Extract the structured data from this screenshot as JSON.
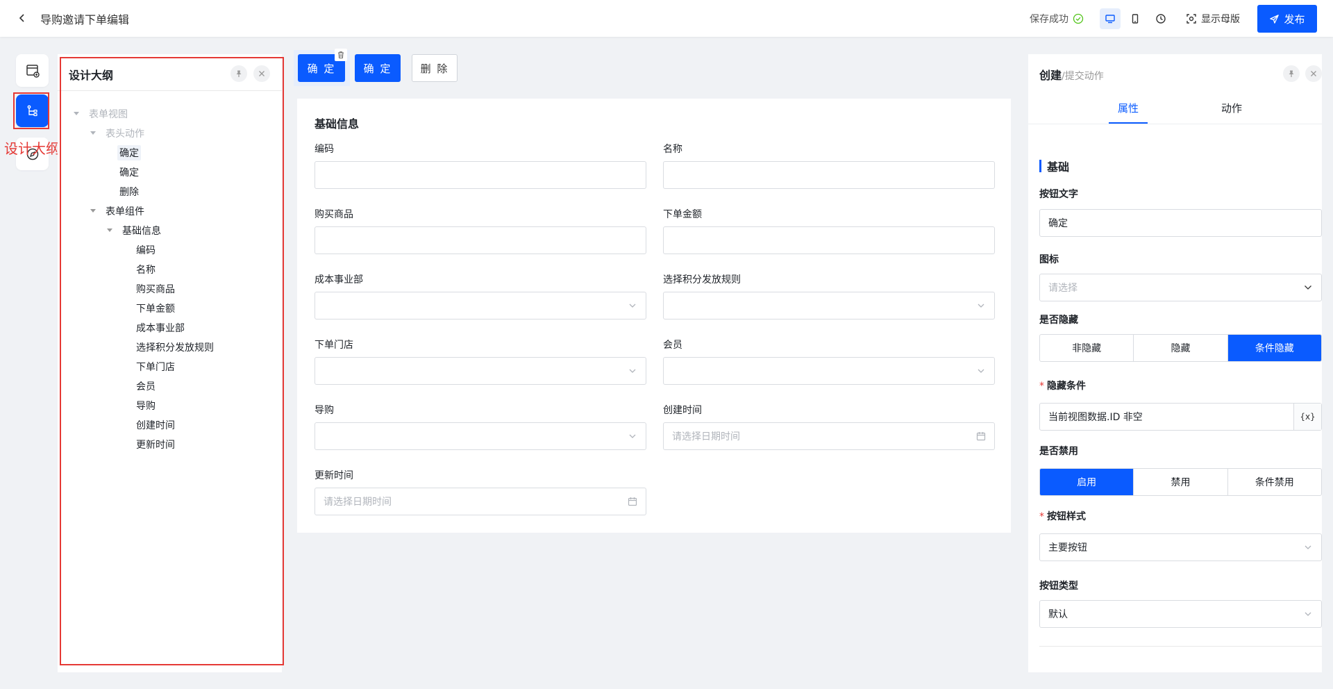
{
  "header": {
    "title": "导购邀请下单编辑",
    "save_status": "保存成功",
    "master_label": "显示母版",
    "publish_label": "发布"
  },
  "rail": {
    "tooltip": "设计大纲"
  },
  "outline": {
    "title": "设计大纲",
    "tree": {
      "root": "表单视图",
      "header_actions": "表头动作",
      "action_1": "确定",
      "action_2": "确定",
      "action_3": "删除",
      "components": "表单组件",
      "basic_info": "基础信息",
      "fields": [
        "编码",
        "名称",
        "购买商品",
        "下单金额",
        "成本事业部",
        "选择积分发放规则",
        "下单门店",
        "会员",
        "导购",
        "创建时间",
        "更新时间"
      ]
    }
  },
  "toolbar": {
    "confirm_1": "确 定",
    "confirm_2": "确 定",
    "delete": "删 除"
  },
  "form": {
    "title": "基础信息",
    "labels": {
      "code": "编码",
      "name": "名称",
      "product": "购买商品",
      "amount": "下单金额",
      "dept": "成本事业部",
      "rule": "选择积分发放规则",
      "store": "下单门店",
      "member": "会员",
      "guide": "导购",
      "created": "创建时间",
      "updated": "更新时间"
    },
    "date_placeholder": "请选择日期时间"
  },
  "props": {
    "title": "创建",
    "subtitle": "/提交动作",
    "tab_props": "属性",
    "tab_actions": "动作",
    "section": "基础",
    "button_text_label": "按钮文字",
    "button_text_value": "确定",
    "icon_label": "图标",
    "icon_placeholder": "请选择",
    "hidden_label": "是否隐藏",
    "hidden_options": [
      "非隐藏",
      "隐藏",
      "条件隐藏"
    ],
    "hidden_selected": "条件隐藏",
    "condition_label": "隐藏条件",
    "condition_value": "当前视图数据.ID 非空",
    "condition_btn": "{x}",
    "disabled_label": "是否禁用",
    "disabled_options": [
      "启用",
      "禁用",
      "条件禁用"
    ],
    "disabled_selected": "启用",
    "style_label": "按钮样式",
    "style_value": "主要按钮",
    "type_label": "按钮类型",
    "type_value": "默认"
  },
  "colors": {
    "primary": "#0a5bff",
    "highlight": "#e53935",
    "success": "#52c41a"
  }
}
